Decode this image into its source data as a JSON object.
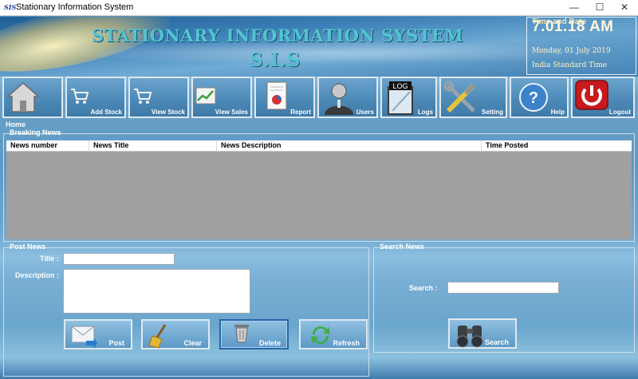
{
  "window": {
    "title": "Stationary Information System",
    "icon_text": "SIS",
    "minimize": "—",
    "maximize": "☐",
    "close": "✕"
  },
  "banner": {
    "title": "STATIONARY INFORMATION SYSTEM",
    "subtitle": "S.I.S"
  },
  "clock": {
    "label": "Time and Date",
    "time": "7.01.18 AM",
    "date": "Monday, 01 July 2019",
    "zone": "India Standard Time"
  },
  "toolbar": {
    "items": [
      {
        "label": "",
        "icon": "home-icon"
      },
      {
        "label": "Add Stock",
        "icon": "cart-icon"
      },
      {
        "label": "View Stock",
        "icon": "cart-icon"
      },
      {
        "label": "View Sales",
        "icon": "sales-chart-icon"
      },
      {
        "label": "Report",
        "icon": "report-icon"
      },
      {
        "label": "Users",
        "icon": "users-icon"
      },
      {
        "label": "Logs",
        "icon": "logs-icon"
      },
      {
        "label": "Setting",
        "icon": "tools-icon"
      },
      {
        "label": "Help",
        "icon": "help-icon"
      },
      {
        "label": "Logout",
        "icon": "power-icon"
      }
    ]
  },
  "breadcrumb": "Home",
  "breaking_news": {
    "title": "Breaking News",
    "columns": [
      "News number",
      "News Title",
      "News Description",
      "Time Posted"
    ],
    "rows": []
  },
  "post_news": {
    "title": "Post News",
    "title_label": "Title :",
    "title_value": "",
    "description_label": "Description :",
    "description_value": "",
    "buttons": {
      "post": "Post",
      "clear": "Clear",
      "delete": "Delete",
      "refresh": "Refresh"
    }
  },
  "search_news": {
    "title": "Search News",
    "search_label": "Search  :",
    "search_value": "",
    "button": "Search"
  }
}
